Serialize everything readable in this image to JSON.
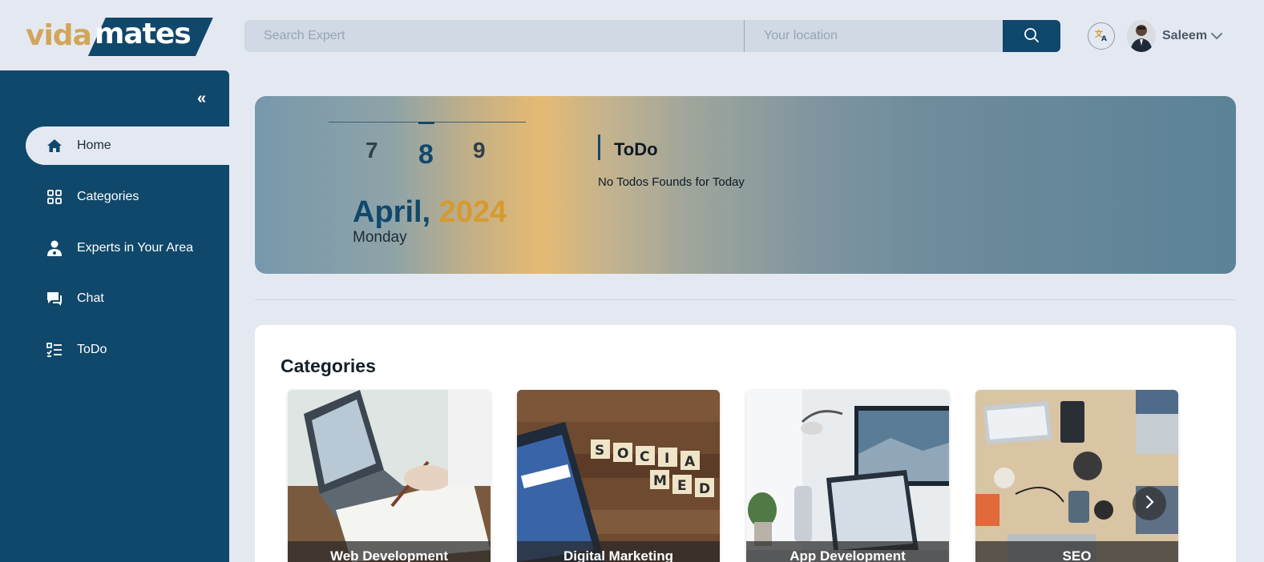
{
  "brand": {
    "part1": "vida",
    "part2": "mates"
  },
  "search": {
    "expert_placeholder": "Search Expert",
    "location_placeholder": "Your location",
    "button_icon": "search-icon"
  },
  "header": {
    "language_icon": "translate-icon",
    "user_name": "Saleem",
    "user_menu_icon": "chevron-down-icon"
  },
  "sidebar": {
    "collapse_label": "«",
    "items": [
      {
        "label": "Home",
        "icon": "home-icon",
        "active": true
      },
      {
        "label": "Categories",
        "icon": "grid-icon",
        "active": false
      },
      {
        "label": "Experts in Your Area",
        "icon": "doctor-icon",
        "active": false
      },
      {
        "label": "Chat",
        "icon": "chat-icon",
        "active": false
      },
      {
        "label": "ToDo",
        "icon": "checklist-icon",
        "active": false
      }
    ]
  },
  "calendar": {
    "prev_day": "7",
    "current_day": "8",
    "next_day": "9",
    "month": "April,",
    "year": "2024",
    "weekday": "Monday"
  },
  "todo": {
    "title": "ToDo",
    "empty_message": "No Todos Founds for Today"
  },
  "categories": {
    "title": "Categories",
    "items": [
      {
        "label": "Web Development"
      },
      {
        "label": "Digital Marketing"
      },
      {
        "label": "App Development"
      },
      {
        "label": "SEO"
      }
    ],
    "next_icon": "chevron-right-icon"
  },
  "colors": {
    "primary": "#10486b",
    "accent": "#d2a65a",
    "background": "#e4e9f1"
  }
}
